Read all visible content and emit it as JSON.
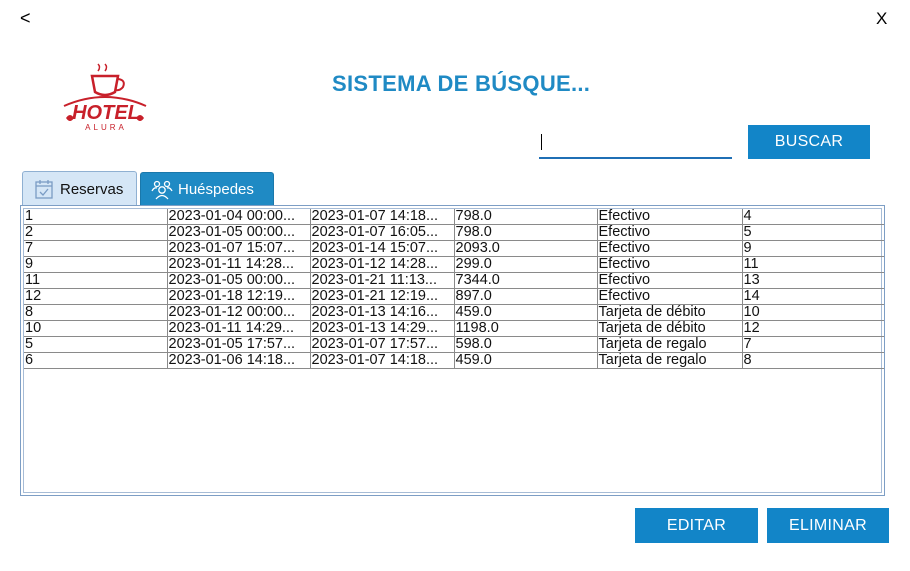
{
  "nav": {
    "back_label": "<",
    "close_label": "X"
  },
  "logo": {
    "word": "HOTEL",
    "sub": "ALURA"
  },
  "header": {
    "title": "SISTEMA DE BÚSQUE..."
  },
  "search": {
    "value": "",
    "button_label": "BUSCAR"
  },
  "tabs": [
    {
      "label": "Reservas",
      "icon": "calendar-check-icon",
      "selected": true
    },
    {
      "label": "Huéspedes",
      "icon": "users-icon",
      "selected": false
    }
  ],
  "reservas": {
    "rows": [
      [
        "1",
        "2023-01-04 00:00...",
        "2023-01-07 14:18...",
        "798.0",
        "Efectivo",
        "4"
      ],
      [
        "2",
        "2023-01-05 00:00...",
        "2023-01-07 16:05...",
        "798.0",
        "Efectivo",
        "5"
      ],
      [
        "7",
        "2023-01-07 15:07...",
        "2023-01-14 15:07...",
        "2093.0",
        "Efectivo",
        "9"
      ],
      [
        "9",
        "2023-01-11 14:28...",
        "2023-01-12 14:28...",
        "299.0",
        "Efectivo",
        "11"
      ],
      [
        "11",
        "2023-01-05 00:00...",
        "2023-01-21 11:13...",
        "7344.0",
        "Efectivo",
        "13"
      ],
      [
        "12",
        "2023-01-18 12:19...",
        "2023-01-21 12:19...",
        "897.0",
        "Efectivo",
        "14"
      ],
      [
        "8",
        "2023-01-12 00:00...",
        "2023-01-13 14:16...",
        "459.0",
        "Tarjeta de débito",
        "10"
      ],
      [
        "10",
        "2023-01-11 14:29...",
        "2023-01-13 14:29...",
        "1198.0",
        "Tarjeta de débito",
        "12"
      ],
      [
        "5",
        "2023-01-05 17:57...",
        "2023-01-07 17:57...",
        "598.0",
        "Tarjeta de regalo",
        "7"
      ],
      [
        "6",
        "2023-01-06 14:18...",
        "2023-01-07 14:18...",
        "459.0",
        "Tarjeta de regalo",
        "8"
      ]
    ]
  },
  "actions": {
    "edit_label": "EDITAR",
    "delete_label": "ELIMINAR"
  },
  "colors": {
    "accent": "#1285c8",
    "title": "#1f8ac4",
    "logo_red": "#c8202a"
  }
}
